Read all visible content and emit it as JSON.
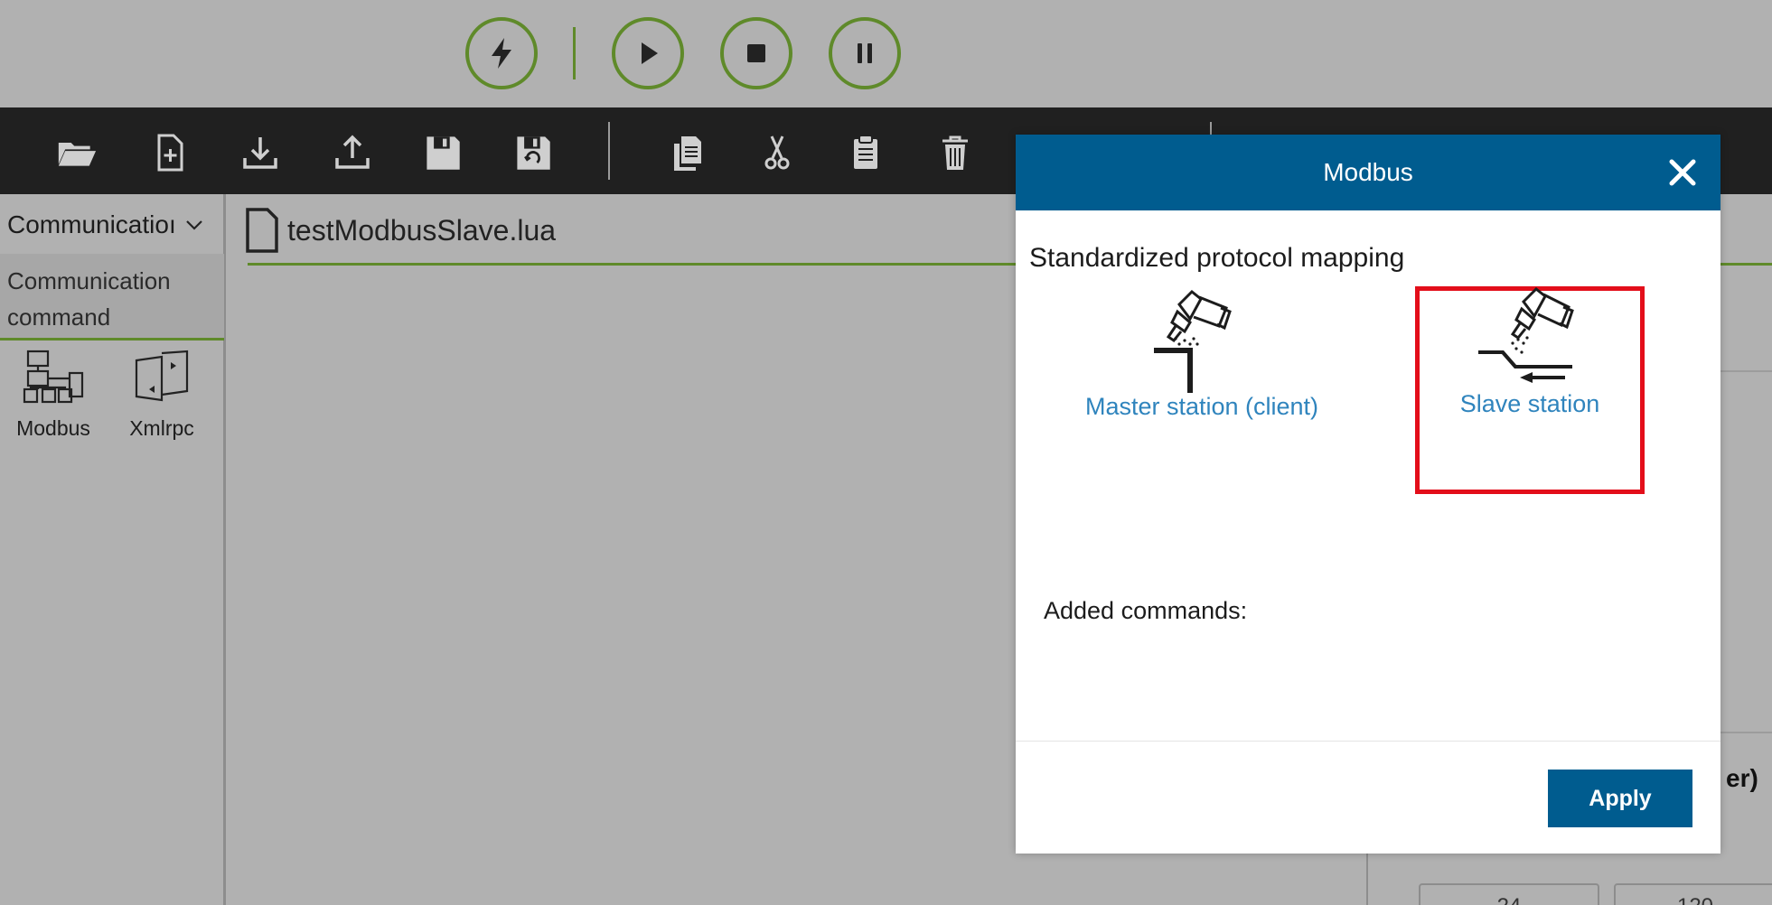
{
  "run_controls": {
    "icons": [
      "bolt-icon",
      "play-icon",
      "stop-icon",
      "pause-icon"
    ]
  },
  "toolbar": {
    "icons": [
      "open-folder-icon",
      "new-file-icon",
      "download-icon",
      "upload-icon",
      "save-icon",
      "save-as-icon",
      "copy-icon",
      "cut-icon",
      "paste-icon",
      "delete-icon"
    ]
  },
  "sidebar": {
    "category_dropdown": "Communicatioı",
    "selected_category": "Communication command",
    "tools": [
      {
        "label": "Modbus",
        "icon": "modbus-icon"
      },
      {
        "label": "Xmlrpc",
        "icon": "xmlrpc-icon"
      }
    ]
  },
  "editor": {
    "file_name": "testModbusSlave.lua"
  },
  "background": {
    "partial_label": "er)",
    "cells": [
      "24",
      "120"
    ]
  },
  "modal": {
    "title": "Modbus",
    "subtitle": "Standardized protocol mapping",
    "options": [
      {
        "label": "Master station (client)",
        "icon": "master-station-icon"
      },
      {
        "label": "Slave station",
        "icon": "slave-station-icon",
        "highlighted": true
      }
    ],
    "added_commands_label": "Added commands:",
    "apply_label": "Apply"
  },
  "colors": {
    "accent_green": "#5f8a2a",
    "modal_blue": "#005c8f",
    "link_blue": "#2f84bd",
    "highlight_red": "#e30e1a"
  }
}
